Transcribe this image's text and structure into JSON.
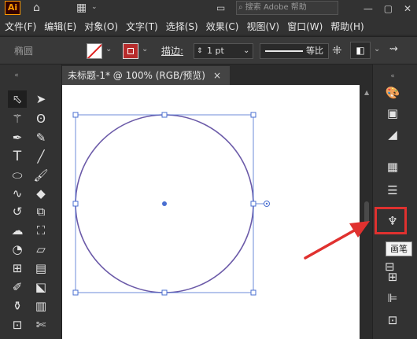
{
  "app": {
    "logo": "Ai",
    "search_placeholder": "搜索 Adobe 帮助"
  },
  "menu": [
    "文件(F)",
    "编辑(E)",
    "对象(O)",
    "文字(T)",
    "选择(S)",
    "效果(C)",
    "视图(V)",
    "窗口(W)",
    "帮助(H)"
  ],
  "control_bar": {
    "selection_label": "椭圆",
    "stroke_label": "描边",
    "stroke_colon": ":",
    "stroke_weight": "1 pt",
    "profile_label": "等比"
  },
  "document_tab": {
    "title": "未标题-1* @ 100% (RGB/预览)",
    "close": "×"
  },
  "tooltip": {
    "text": "画笔"
  },
  "colors": {
    "accent_red": "#e0312f",
    "selection_blue": "#4a6fd1",
    "circle_stroke": "#6b5aa8"
  },
  "icons": [
    "home-icon",
    "workspace-icon",
    "arrange-icon",
    "search-icon",
    "minimize-icon",
    "maximize-icon",
    "close-icon",
    "selection-tool-icon",
    "direct-selection-icon",
    "magic-wand-icon",
    "lasso-icon",
    "pen-icon",
    "curvature-icon",
    "type-icon",
    "line-icon",
    "ellipse-icon",
    "paintbrush-icon",
    "shaper-icon",
    "eraser-icon",
    "rotate-icon",
    "scale-icon",
    "warp-icon",
    "free-transform-icon",
    "shape-builder-icon",
    "perspective-icon",
    "mesh-icon",
    "gradient-icon",
    "eyedropper-icon",
    "blend-icon",
    "symbol-sprayer-icon",
    "graph-icon",
    "artboard-icon",
    "slice-icon",
    "color-panel-icon",
    "libraries-icon",
    "color-guide-icon",
    "swatches-icon",
    "lines-icon",
    "brushes-icon",
    "symbols-icon",
    "graphic-styles-icon",
    "transform-icon",
    "align-icon",
    "pathfinder-icon"
  ]
}
